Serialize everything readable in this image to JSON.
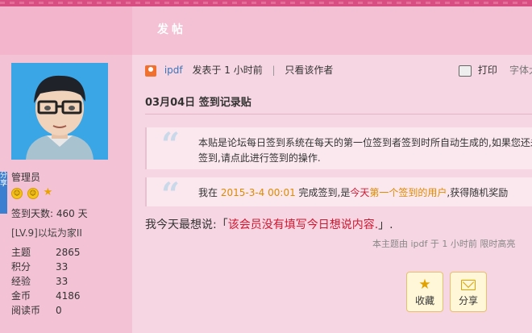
{
  "header": {
    "post_button": "发帖"
  },
  "sidebar": {
    "side_tab": [
      "分",
      "享"
    ],
    "role": "管理员",
    "sign_days_label": "签到天数:",
    "sign_days_value": "460 天",
    "level": "[LV.9]以坛为家II",
    "stats": [
      {
        "key": "主题",
        "value": "2865"
      },
      {
        "key": "积分",
        "value": "33"
      },
      {
        "key": "经验",
        "value": "33"
      },
      {
        "key": "金币",
        "value": "4186"
      },
      {
        "key": "阅读币",
        "value": "0"
      }
    ]
  },
  "meta": {
    "author": "ipdf",
    "posted": "发表于 1 小时前",
    "only_author": "只看该作者",
    "print": "打印",
    "font_size": "字体大"
  },
  "thread_title": "03月04日 签到记录贴",
  "quote1": "本贴是论坛每日签到系统在每天的第一位签到者签到时所自动生成的,如果您还未签到,请点此进行签到的操作.",
  "quote2": {
    "prefix": "我在",
    "datetime": "2015-3-4 00:01",
    "mid": "完成签到,是",
    "today": "今天",
    "first_user": "第一个签到的用户",
    "suffix": ",获得随机奖励"
  },
  "message": {
    "prefix": "我今天最想说:「",
    "content": "该会员没有填写今日想说内容.",
    "suffix": "」."
  },
  "edited_note": "本主题由 ipdf 于 1 小时前 限时高亮",
  "actions": {
    "favorite": "收藏",
    "share": "分享"
  },
  "colors": {
    "accent": "#d84e82",
    "link": "#3b74b8",
    "highlight": "#d2162f"
  }
}
